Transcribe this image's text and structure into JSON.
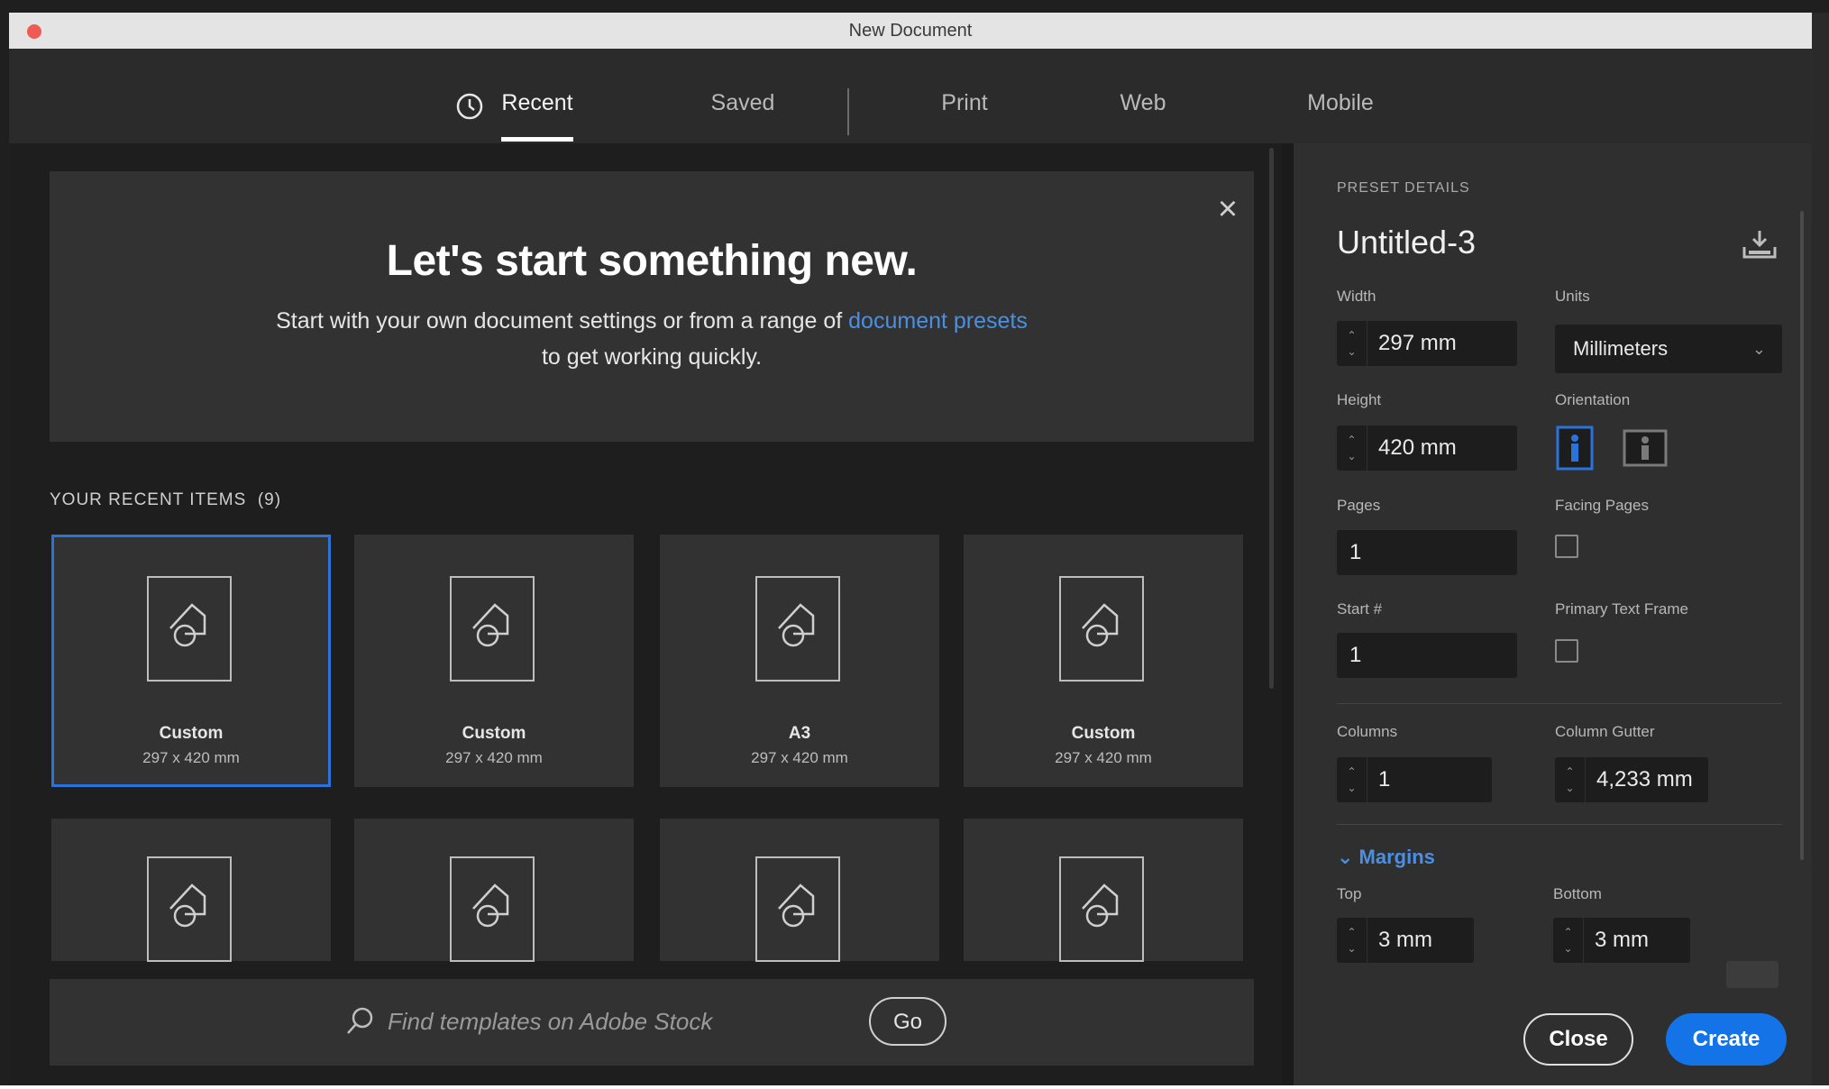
{
  "window": {
    "title": "New Document"
  },
  "tabs": [
    {
      "label": "Recent",
      "active": true
    },
    {
      "label": "Saved",
      "active": false
    },
    {
      "label": "Print",
      "active": false
    },
    {
      "label": "Web",
      "active": false
    },
    {
      "label": "Mobile",
      "active": false
    }
  ],
  "welcome": {
    "title": "Let's start something new.",
    "line1_prefix": "Start with your own document settings or from a range of ",
    "link_text": "document presets",
    "line2": "to get working quickly."
  },
  "recent": {
    "heading": "YOUR RECENT ITEMS",
    "count": "(9)",
    "items": [
      {
        "name": "Custom",
        "size": "297 x 420 mm",
        "selected": true
      },
      {
        "name": "Custom",
        "size": "297 x 420 mm",
        "selected": false
      },
      {
        "name": "A3",
        "size": "297 x 420 mm",
        "selected": false
      },
      {
        "name": "Custom",
        "size": "297 x 420 mm",
        "selected": false
      }
    ]
  },
  "search": {
    "placeholder": "Find templates on Adobe Stock",
    "value": "",
    "go_label": "Go"
  },
  "preset": {
    "section_label": "PRESET DETAILS",
    "name": "Untitled-3",
    "width_label": "Width",
    "width_value": "297 mm",
    "units_label": "Units",
    "units_value": "Millimeters",
    "height_label": "Height",
    "height_value": "420 mm",
    "orientation_label": "Orientation",
    "pages_label": "Pages",
    "pages_value": "1",
    "facing_label": "Facing Pages",
    "start_label": "Start #",
    "start_value": "1",
    "primary_label": "Primary Text Frame",
    "columns_label": "Columns",
    "columns_value": "1",
    "gutter_label": "Column Gutter",
    "gutter_value": "4,233 mm",
    "margins_label": "Margins",
    "top_label": "Top",
    "top_value": "3 mm",
    "bottom_label": "Bottom",
    "bottom_value": "3 mm"
  },
  "actions": {
    "close_label": "Close",
    "create_label": "Create"
  },
  "colors": {
    "accent": "#1473e6",
    "link": "#4a90e2",
    "selection": "#2a73d9"
  }
}
